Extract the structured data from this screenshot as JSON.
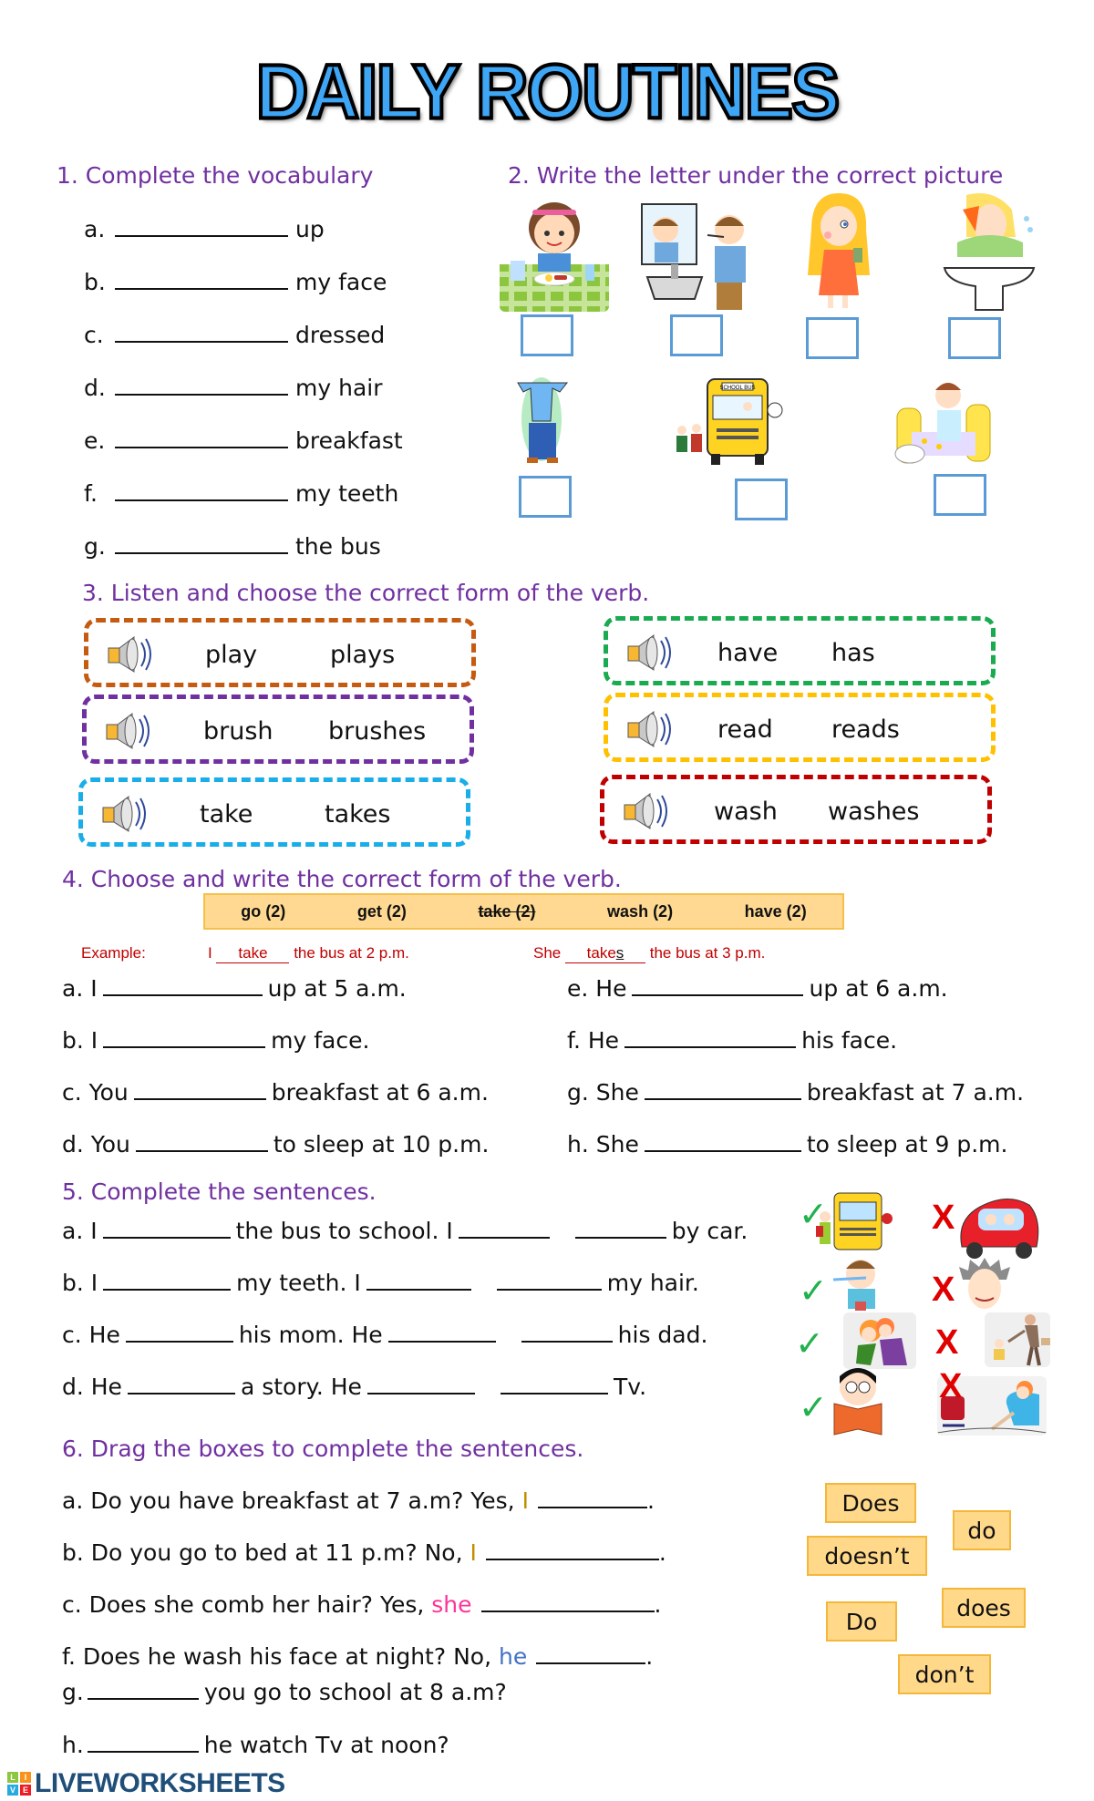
{
  "title": "DAILY ROUTINES",
  "section1": {
    "heading": "1.  Complete the vocabulary",
    "items": [
      {
        "letter": "a.",
        "text": "up"
      },
      {
        "letter": "b.",
        "text": "my face"
      },
      {
        "letter": "c.",
        "text": "dressed"
      },
      {
        "letter": "d.",
        "text": "my hair"
      },
      {
        "letter": "e.",
        "text": "breakfast"
      },
      {
        "letter": "f.",
        "text": "my teeth"
      },
      {
        "letter": "g.",
        "text": "the bus"
      }
    ]
  },
  "section2": {
    "heading": "2. Write the letter under the correct picture",
    "pictures": [
      {
        "icon": "girl-eating-breakfast-picture"
      },
      {
        "icon": "boy-brushing-teeth-picture"
      },
      {
        "icon": "girl-combing-hair-picture"
      },
      {
        "icon": "boy-washing-face-picture"
      },
      {
        "icon": "boy-getting-dressed-picture"
      },
      {
        "icon": "school-bus-picture",
        "label": "SCHOOL BUS"
      },
      {
        "icon": "boy-getting-up-picture"
      }
    ]
  },
  "section3": {
    "heading": "3. Listen and choose the correct form of the verb.",
    "pairs": [
      {
        "base": "play",
        "third": "plays",
        "color": "#c55a11"
      },
      {
        "base": "brush",
        "third": "brushes",
        "color": "#7030a0"
      },
      {
        "base": "take",
        "third": "takes",
        "color": "#1aaee8"
      },
      {
        "base": "have",
        "third": "has",
        "color": "#1aaa50"
      },
      {
        "base": "read",
        "third": "reads",
        "color": "#ffc000"
      },
      {
        "base": "wash",
        "third": "washes",
        "color": "#c00000"
      }
    ]
  },
  "section4": {
    "heading": "4. Choose and write the correct form of the verb.",
    "word_bank": [
      "go (2)",
      "get (2)",
      "take (2)",
      "wash (2)",
      "have (2)"
    ],
    "struck_word": "take (2)",
    "example": {
      "label": "Example:",
      "s1_subject": "I",
      "s1_answer": "take",
      "s1_rest": "the bus at 2 p.m.",
      "s2_subject": "She",
      "s2_answer": "take",
      "s2_suffix": "s",
      "s2_rest": "the bus at 3 p.m."
    },
    "left": [
      {
        "prefix": "a. I",
        "rest": "up at 5 a.m."
      },
      {
        "prefix": "b. I",
        "rest": "my face."
      },
      {
        "prefix": "c. You",
        "rest": "breakfast at 6 a.m."
      },
      {
        "prefix": "d. You",
        "rest": "to sleep at 10 p.m."
      }
    ],
    "right": [
      {
        "prefix": "e. He",
        "rest": "up at 6 a.m."
      },
      {
        "prefix": "f. He",
        "rest": "his face."
      },
      {
        "prefix": "g. She",
        "rest": "breakfast at 7 a.m."
      },
      {
        "prefix": "h. She",
        "rest": "to sleep at 9 p.m."
      }
    ]
  },
  "section5": {
    "heading": "5. Complete the sentences.",
    "items": [
      {
        "p1": "a. I",
        "p2": "the bus to school. I",
        "p3": "by car."
      },
      {
        "p1": "b. I",
        "p2": "my teeth. I",
        "p3": "my hair."
      },
      {
        "p1": "c. He",
        "p2": "his mom. He",
        "p3": "his dad."
      },
      {
        "p1": "d. He",
        "p2": "a story. He",
        "p3": "Tv."
      }
    ],
    "check_mark": "✓",
    "cross_mark": "X"
  },
  "section6": {
    "heading": "6. Drag the boxes to complete the sentences.",
    "items": [
      {
        "pre": "a. Do you have breakfast at 7 a.m? Yes, ",
        "pronoun": "I",
        "pronoun_color": "#bf8f00",
        "post": "."
      },
      {
        "pre": "b. Do you go to bed at 11 p.m? No, ",
        "pronoun": "I",
        "pronoun_color": "#bf8f00",
        "post": "."
      },
      {
        "pre": "c. Does she comb her hair? Yes, ",
        "pronoun": "she",
        "pronoun_color": "#ff3399",
        "post": "."
      },
      {
        "pre": "f. Does he wash his face at night? No, ",
        "pronoun": "he",
        "pronoun_color": "#4472c4",
        "post": "."
      }
    ],
    "questions": [
      {
        "letter": "g.",
        "rest": "you go to school at 8 a.m?"
      },
      {
        "letter": "h.",
        "rest": "he watch Tv at noon?"
      }
    ],
    "tiles": [
      "Does",
      "do",
      "doesn’t",
      "Do",
      "does",
      "don’t"
    ]
  },
  "footer": {
    "logo_letters": [
      "L",
      "I",
      "V",
      "E"
    ],
    "logo_text": "LIVEWORKSHEETS"
  }
}
